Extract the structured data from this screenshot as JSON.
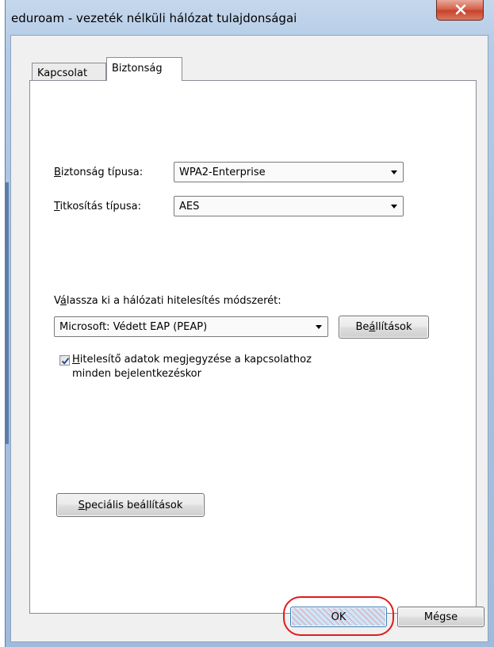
{
  "window": {
    "title": "eduroam - vezeték nélküli hálózat tulajdonságai"
  },
  "tabs": [
    {
      "label": "Kapcsolat",
      "active": false
    },
    {
      "label": "Biztonság",
      "active": true
    }
  ],
  "security": {
    "security_type_label_u": "B",
    "security_type_label_rest": "iztonság típusa:",
    "security_type_value": "WPA2-Enterprise",
    "encryption_type_label_u": "T",
    "encryption_type_label_rest": "itkosítás típusa:",
    "encryption_type_value": "AES",
    "auth_method_label_pre": "V",
    "auth_method_label_u": "á",
    "auth_method_label_rest": "lassza ki a hálózati hitelesítés módszerét:",
    "auth_method_value": "Microsoft: Védett EAP (PEAP)",
    "settings_button_pre": "Be",
    "settings_button_u": "á",
    "settings_button_rest": "llítások",
    "remember_checked": true,
    "remember_line1_u": "H",
    "remember_line1_rest": "itelesítő adatok megjegyzése a kapcsolathoz",
    "remember_line2": "minden bejelentkezéskor",
    "advanced_button_u": "S",
    "advanced_button_rest": "peciális beállítások"
  },
  "footer": {
    "ok_label": "OK",
    "cancel_label": "Mégse"
  },
  "colors": {
    "highlight_ring": "#e11b1b",
    "ok_focus_border": "#3c7fb1"
  },
  "icons": {
    "close": "close-icon",
    "check": "checkmark-icon",
    "dropdown": "chevron-down-icon"
  }
}
